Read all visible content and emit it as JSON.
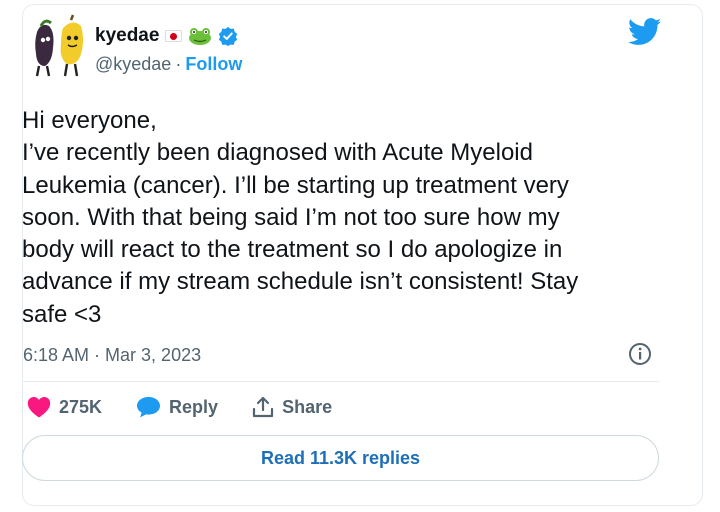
{
  "author": {
    "display_name": "kyedae",
    "handle": "@kyedae",
    "separator": "·",
    "follow_label": "Follow"
  },
  "tweet": {
    "text": "Hi everyone,\nI’ve recently been diagnosed with Acute Myeloid\nLeukemia (cancer). I’ll be starting up treatment very\nsoon. With that being said I’m not too sure how my\nbody will react to the treatment so I do apologize in\nadvance if my stream schedule isn’t consistent! Stay\nsafe <3",
    "time": "6:18 AM",
    "separator": "·",
    "date": "Mar 3, 2023"
  },
  "actions": {
    "likes": "275K",
    "reply_label": "Reply",
    "share_label": "Share"
  },
  "read_replies_label": "Read 11.3K replies",
  "colors": {
    "twitter_blue": "#1d9bf0",
    "like_pink": "#f91880",
    "text": "#0f1419",
    "muted": "#536471"
  },
  "icons": [
    "avatar-banana-figures",
    "japan-flag-icon",
    "frog-emoji-icon",
    "verified-badge-icon",
    "twitter-bird-icon",
    "info-icon",
    "heart-icon",
    "reply-bubble-icon",
    "share-icon"
  ]
}
